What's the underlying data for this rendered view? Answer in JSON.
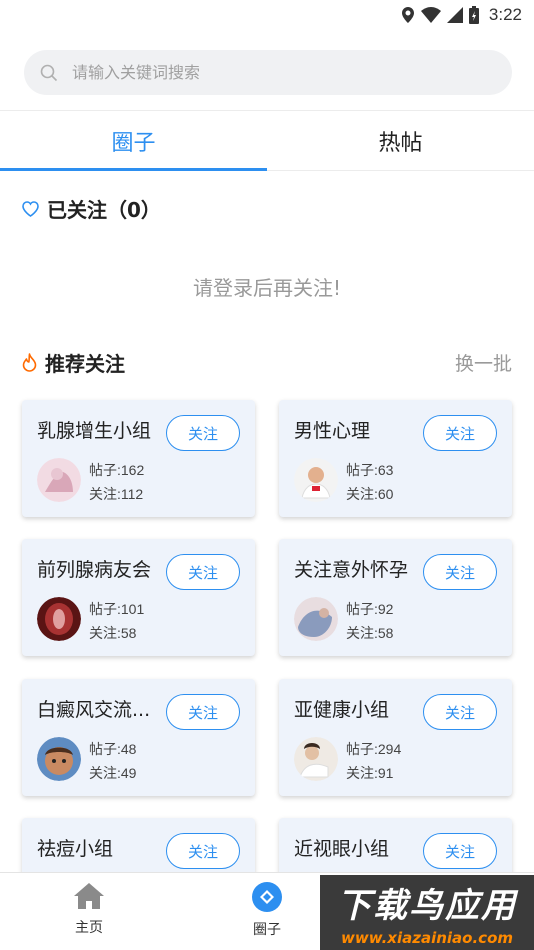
{
  "status_bar": {
    "time": "3:22"
  },
  "search": {
    "placeholder": "请输入关键词搜索"
  },
  "tabs": [
    {
      "label": "圈子",
      "active": true
    },
    {
      "label": "热帖",
      "active": false
    }
  ],
  "followed": {
    "title": "已关注（0）",
    "empty_hint": "请登录后再关注!"
  },
  "recommend": {
    "title": "推荐关注",
    "refresh_label": "换一批"
  },
  "cards": [
    {
      "title": "乳腺增生小组",
      "posts": "帖子:162",
      "follows": "关注:112",
      "button": "关注",
      "avatar_color": "#d9a7b8"
    },
    {
      "title": "男性心理",
      "posts": "帖子:63",
      "follows": "关注:60",
      "button": "关注",
      "avatar_color": "#e3b08e"
    },
    {
      "title": "前列腺病友会",
      "posts": "帖子:101",
      "follows": "关注:58",
      "button": "关注",
      "avatar_color": "#8e2b2b"
    },
    {
      "title": "关注意外怀孕",
      "posts": "帖子:92",
      "follows": "关注:58",
      "button": "关注",
      "avatar_color": "#8a9bbd"
    },
    {
      "title": "白癜风交流...",
      "posts": "帖子:48",
      "follows": "关注:49",
      "button": "关注",
      "avatar_color": "#6b4a3a"
    },
    {
      "title": "亚健康小组",
      "posts": "帖子:294",
      "follows": "关注:91",
      "button": "关注",
      "avatar_color": "#c7b9a6"
    },
    {
      "title": "祛痘小组",
      "posts": "",
      "follows": "",
      "button": "关注",
      "avatar_color": "#d8c2b0"
    },
    {
      "title": "近视眼小组",
      "posts": "",
      "follows": "",
      "button": "关注",
      "avatar_color": "#b9c7d8"
    }
  ],
  "bottom_nav": [
    {
      "label": "主页",
      "icon": "home-icon"
    },
    {
      "label": "圈子",
      "icon": "circle-icon"
    }
  ],
  "watermark": {
    "main": "下载鸟应用",
    "url": "www.xiazainiao.com"
  },
  "colors": {
    "accent": "#2d8ff0",
    "fire": "#ff6a00"
  }
}
